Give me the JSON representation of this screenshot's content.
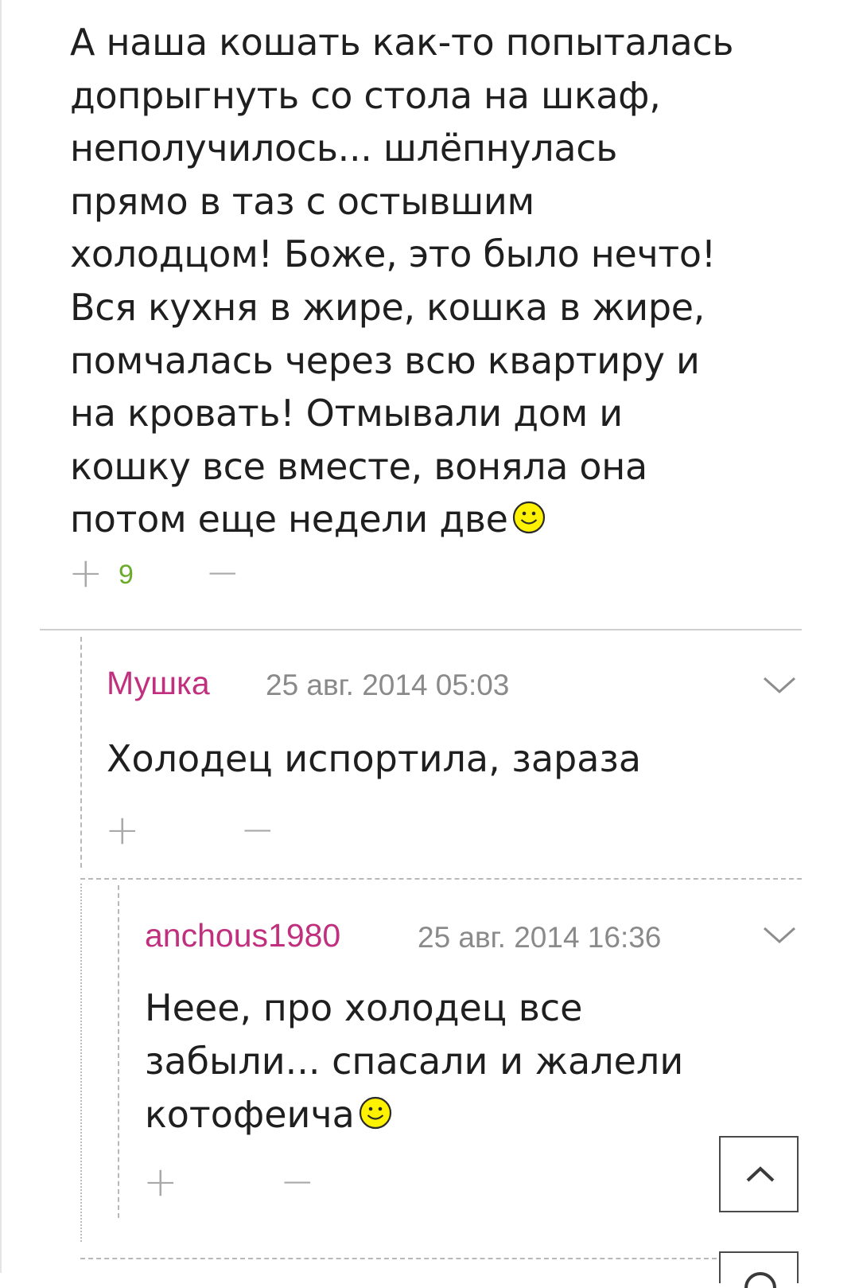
{
  "main_comment": {
    "lines": [
      "А наша кошать как-то попыталась",
      "допрыгнуть со стола на шкаф,",
      "неполучилось... шлёпнулась",
      "прямо в таз с остывшим",
      "холодцом! Боже, это было нечто!",
      "Вся кухня в жире, кошка в жире,",
      "помчалась через всю квартиру и",
      "на кровать! Отмывали дом и",
      "кошку все вместе, воняла она",
      "потом еще недели две"
    ],
    "smiley": "smiley-emoticon",
    "vote_plus": "+",
    "rating": "9",
    "vote_minus": "−"
  },
  "reply_1": {
    "author": "Мушка",
    "date": "25 авг. 2014 05:03",
    "text": "Холодец испортила, зараза",
    "vote_plus": "+",
    "vote_minus": "−",
    "menu_icon": "chevron-down-icon"
  },
  "reply_2": {
    "author": "anchous1980",
    "date": "25 авг. 2014 16:36",
    "lines": [
      "Неее, про холодец все",
      "забыли... спасали и жалели",
      "котофеича"
    ],
    "smiley": "smiley-emoticon",
    "vote_plus": "+",
    "vote_minus": "−",
    "menu_icon": "chevron-down-icon"
  },
  "scroll_top_icon": "chevron-up-icon",
  "colors": {
    "author": "#c1307f",
    "rating_positive": "#6aab2c",
    "meta_gray": "#8a8a8a"
  }
}
